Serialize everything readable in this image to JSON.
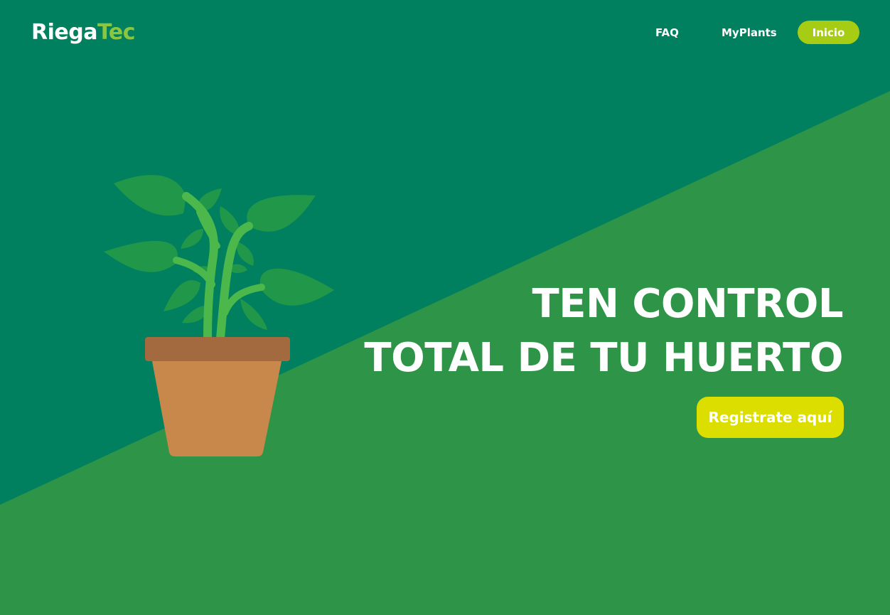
{
  "brand": {
    "part1": "Riega",
    "part2": "Tec",
    "color_part1": "#ffffff",
    "color_part2": "#8cc63e"
  },
  "nav": {
    "faq_label": "FAQ",
    "myplants_label": "MyPlants",
    "inicio_label": "Inicio",
    "inicio_bg": "#a7cc14"
  },
  "hero": {
    "title_line1": "TEN CONTROL",
    "title_line2": "TOTAL DE TU HUERTO",
    "cta_label": "Registrate aquí",
    "cta_bg": "#dcde00"
  },
  "theme": {
    "bg_dark": "#00805e",
    "bg_light": "#2e9447"
  },
  "icons": {
    "hero_image": "potted-plant-icon"
  }
}
